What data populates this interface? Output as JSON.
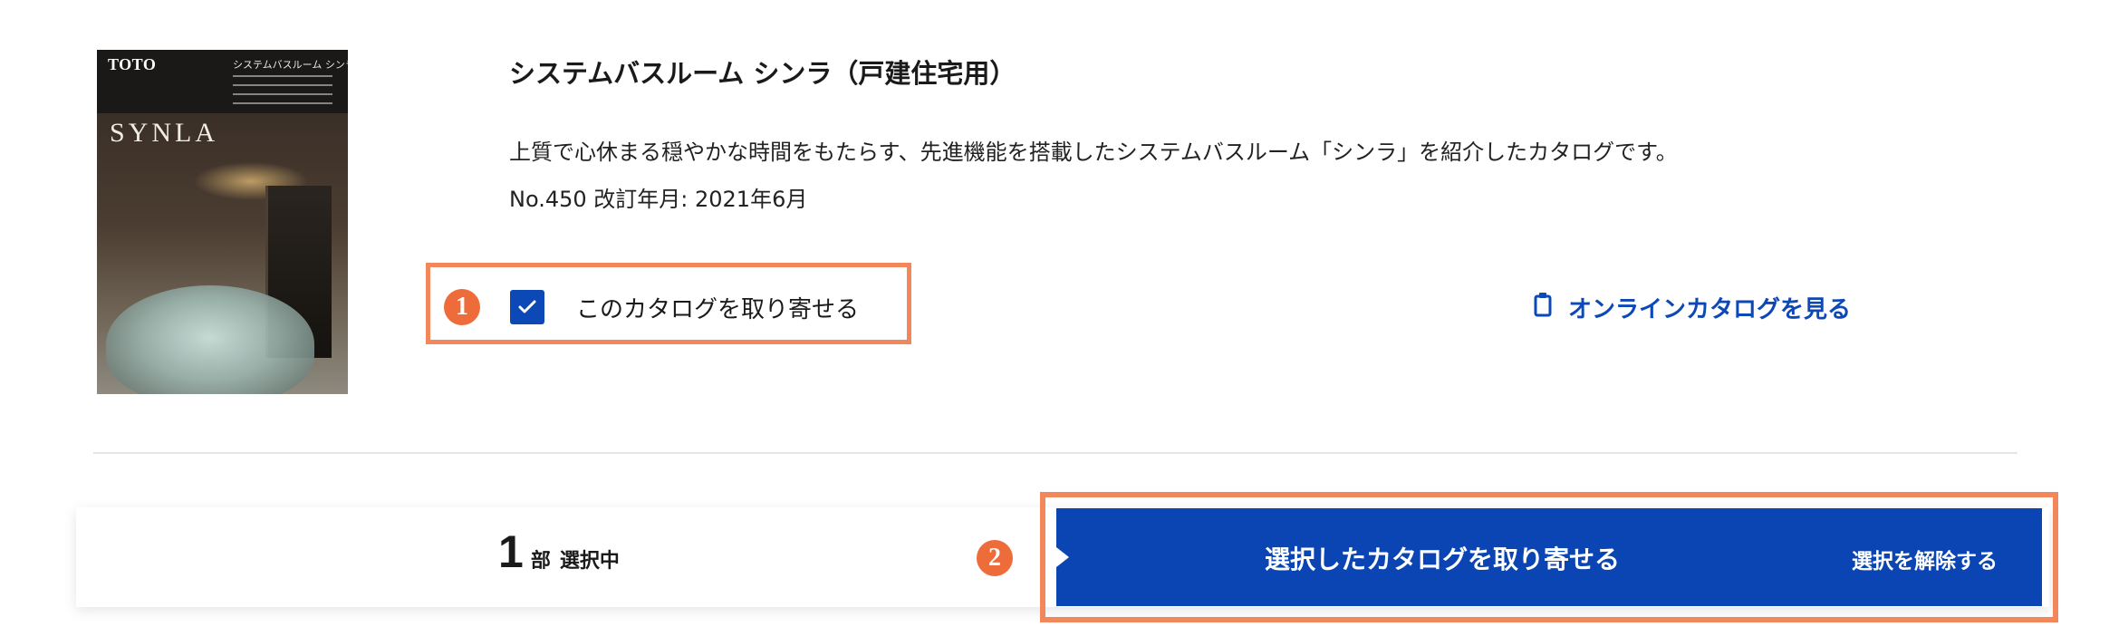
{
  "catalog": {
    "cover": {
      "brand": "TOTO",
      "series_small": "システムバスルーム シンラ",
      "name": "SYNLA"
    },
    "title": "システムバスルーム シンラ（戸建住宅用）",
    "description": "上質で心休まる穏やかな時間をもたらす、先進機能を搭載したシステムバスルーム「シンラ」を紹介したカタログです。",
    "meta": "No.450 改訂年月: 2021年6月",
    "request_label": "このカタログを取り寄せる",
    "request_checked": true,
    "online_label": "オンラインカタログを見る"
  },
  "annotations": {
    "badge_1": "1",
    "badge_2": "2",
    "highlight_color": "#f2875c"
  },
  "bottom_bar": {
    "count": "1",
    "count_unit": "部",
    "count_status": "選択中",
    "action_label": "選択したカタログを取り寄せる",
    "clear_label": "選択を解除する"
  },
  "colors": {
    "primary": "#0b45b4",
    "accent": "#ee6b3a"
  }
}
